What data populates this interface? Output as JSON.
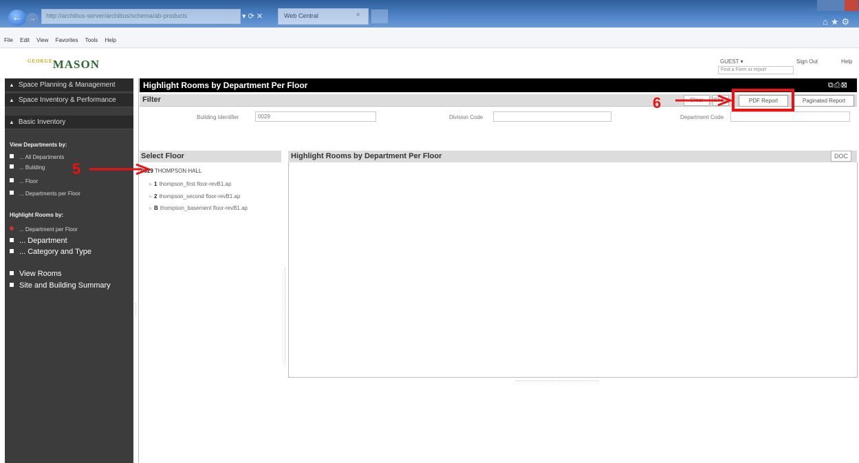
{
  "browser": {
    "address": "http://archibus-server/archibus/schema/ab-products",
    "address_controls": "▾ ⟳ ✕",
    "tab_label": "Web Central",
    "tab_close": "×",
    "right_icons": "⌂★⚙",
    "menu": [
      "File",
      "Edit",
      "View",
      "Favorites",
      "Tools",
      "Help"
    ]
  },
  "header": {
    "logo_text": "MASON",
    "logo_small": "GEORGE",
    "guest": "GUEST ▾",
    "sign_out": "Sign Out",
    "help": "Help",
    "search_placeholder": "Find a Form or report"
  },
  "sidebar": {
    "nav_heads": [
      "Space Planning & Management",
      "Space Inventory & Performance",
      "Basic Inventory"
    ],
    "view_departments_heading": "View Departments by:",
    "view_departments_items": [
      "... All Departments",
      "... Building",
      "... Floor",
      "... Departments per Floor"
    ],
    "highlight_heading": "Highlight Rooms by:",
    "highlight_items": [
      "... Department per Floor",
      "... Department",
      "... Category and Type"
    ],
    "other_items": [
      "View Rooms",
      "Site and Building Summary"
    ]
  },
  "main": {
    "title": "Highlight Rooms by Department Per Floor",
    "header_icons": "⧉⎙⊠",
    "filter": {
      "title": "Filter",
      "clear_label": "Clear",
      "show_label": "Show",
      "pdf_label": "PDF Report",
      "paginated_label": "Paginated Report",
      "building_label": "Building Identifier",
      "building_value": "0029",
      "division_label": "Division Code",
      "division_value": "",
      "department_label": "Department Code",
      "department_value": ""
    },
    "select_floor": {
      "title": "Select Floor",
      "root_code": "0029",
      "root_name": "THOMPSON HALL",
      "floors": [
        {
          "id": "1",
          "name": "thompson_first floor-revB1.ap"
        },
        {
          "id": "2",
          "name": "thompson_second floor-revB1.ap"
        },
        {
          "id": "B",
          "name": "thompson_basement floor-revB1.ap"
        }
      ]
    },
    "report": {
      "title": "Highlight Rooms by Department Per Floor",
      "doc_label": "DOC"
    }
  },
  "callouts": {
    "five": "5",
    "six": "6",
    "color": "#ee1111"
  }
}
